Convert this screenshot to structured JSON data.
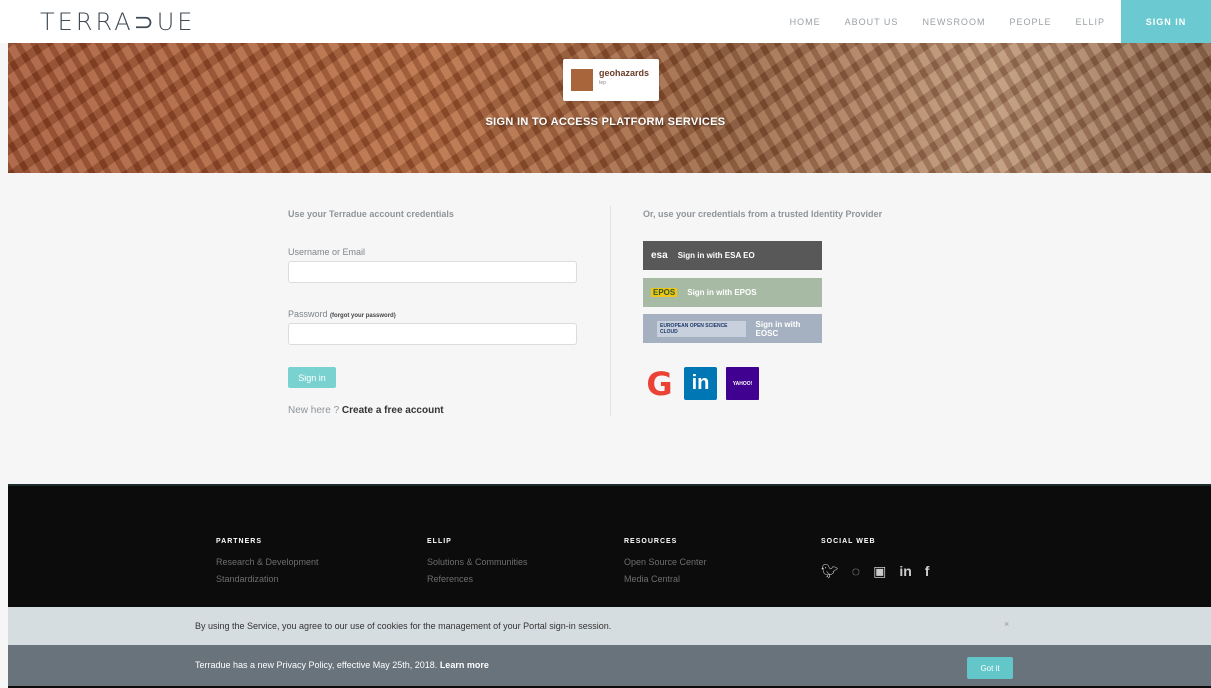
{
  "header": {
    "logo": "TERRA⊃UE",
    "nav": [
      "HOME",
      "ABOUT US",
      "NEWSROOM",
      "PEOPLE",
      "ELLIP"
    ],
    "signin": "SIGN IN"
  },
  "hero": {
    "platform_name": "geohazards",
    "platform_sub": "tep",
    "title": "SIGN IN TO ACCESS PLATFORM SERVICES"
  },
  "login": {
    "left_title": "Use your Terradue account credentials",
    "username_label": "Username or Email",
    "username_value": "",
    "password_label": "Password",
    "forgot_link": "(forgot your password)",
    "password_value": "",
    "signin_button": "Sign in",
    "new_here": "New here ?",
    "create_account": "Create a free account"
  },
  "idp": {
    "title": "Or, use your credentials from a trusted Identity Provider",
    "esa_tag": "esa",
    "esa_label": "Sign in with ESA EO",
    "epos_tag": "EPOS",
    "epos_label": "Sign in with EPOS",
    "eosc_tag": "EUROPEAN OPEN SCIENCE CLOUD",
    "eosc_label": "Sign in with EOSC",
    "google": "G",
    "linkedin": "in",
    "yahoo": "YAHOO!"
  },
  "footer": {
    "partners": {
      "title": "PARTNERS",
      "links": [
        "Research & Development",
        "Standardization"
      ]
    },
    "ellip": {
      "title": "ELLIP",
      "links": [
        "Solutions & Communities",
        "References"
      ]
    },
    "resources": {
      "title": "RESOURCES",
      "links": [
        "Open Source Center",
        "Media Central"
      ]
    },
    "social": {
      "title": "SOCIAL WEB"
    }
  },
  "cookie": {
    "notice": "By using the Service, you agree to our use of cookies for the management of your Portal sign-in session.",
    "close": "×",
    "privacy": "Terradue has a new Privacy Policy, effective May 25th, 2018.",
    "learn_more": "Learn more",
    "got_it": "Got it"
  }
}
